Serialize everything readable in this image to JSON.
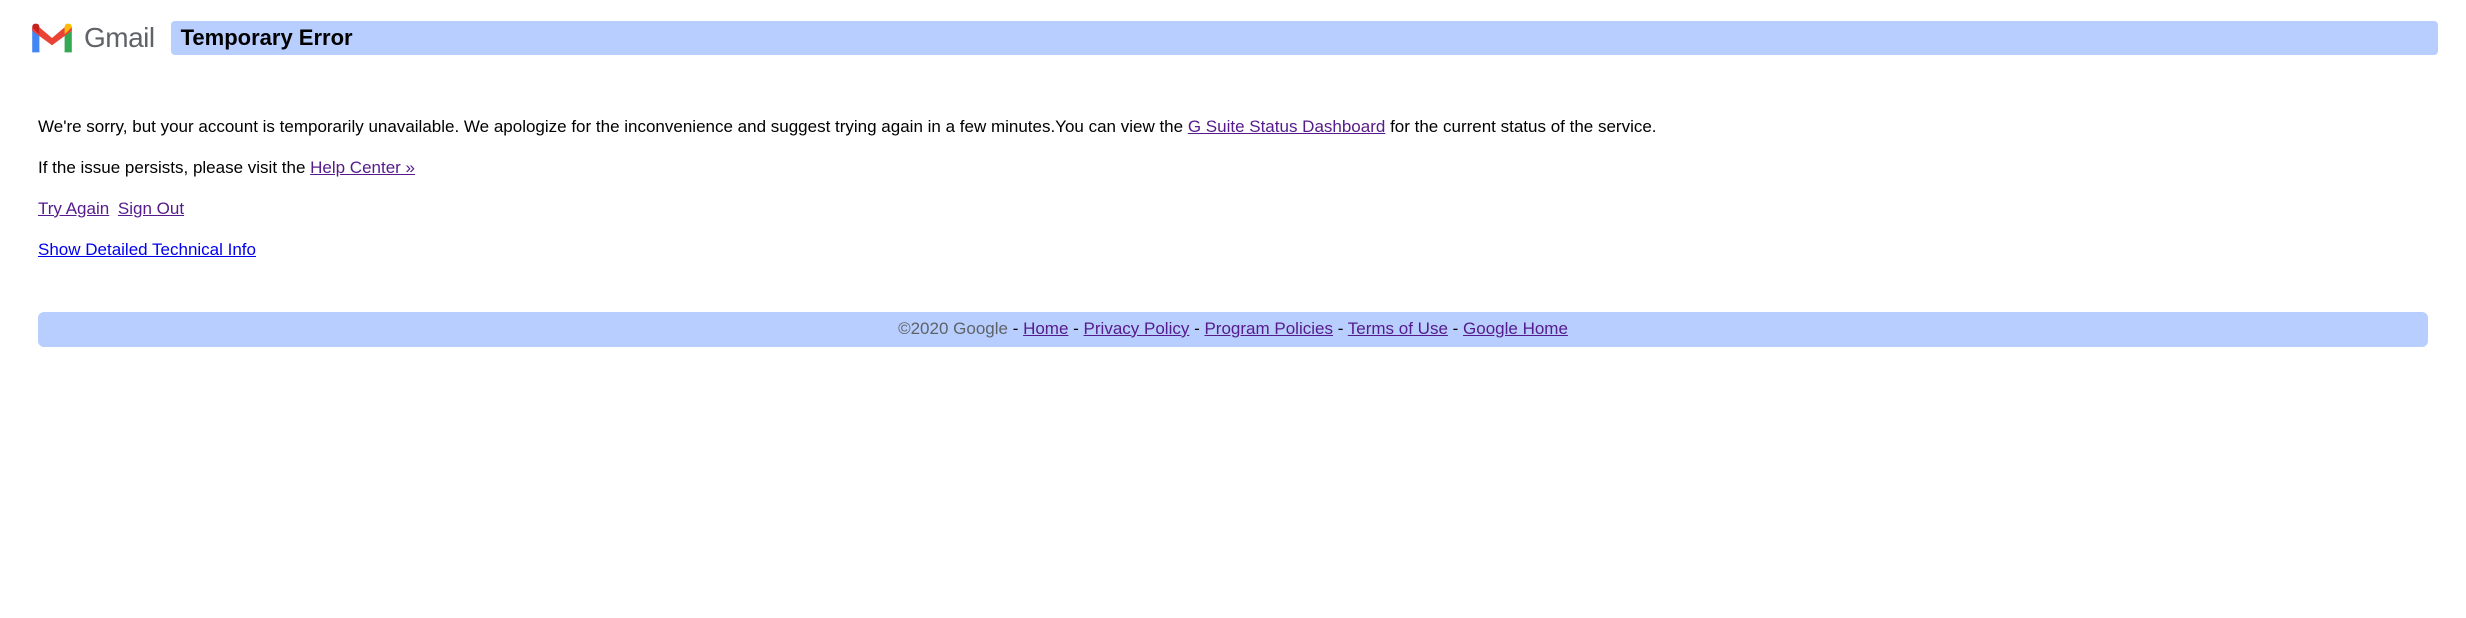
{
  "header": {
    "logo_text": "Gmail",
    "title": "Temporary Error"
  },
  "body": {
    "apology_part1": "We're sorry, but your account is temporarily unavailable. We apologize for the inconvenience and suggest trying again in a few minutes.You can view the ",
    "status_link": "G Suite Status Dashboard",
    "apology_part2": " for the current status of the service.",
    "persist_part1": "If the issue persists, please visit the ",
    "help_center_link": "Help Center »",
    "try_again": "Try Again",
    "sign_out": "Sign Out",
    "detail_link": "Show Detailed Technical Info"
  },
  "footer": {
    "copyright": "©2020 Google",
    "sep": " - ",
    "links": {
      "home": "Home",
      "privacy": "Privacy Policy",
      "program": "Program Policies",
      "terms": "Terms of Use",
      "google_home": "Google Home"
    }
  }
}
